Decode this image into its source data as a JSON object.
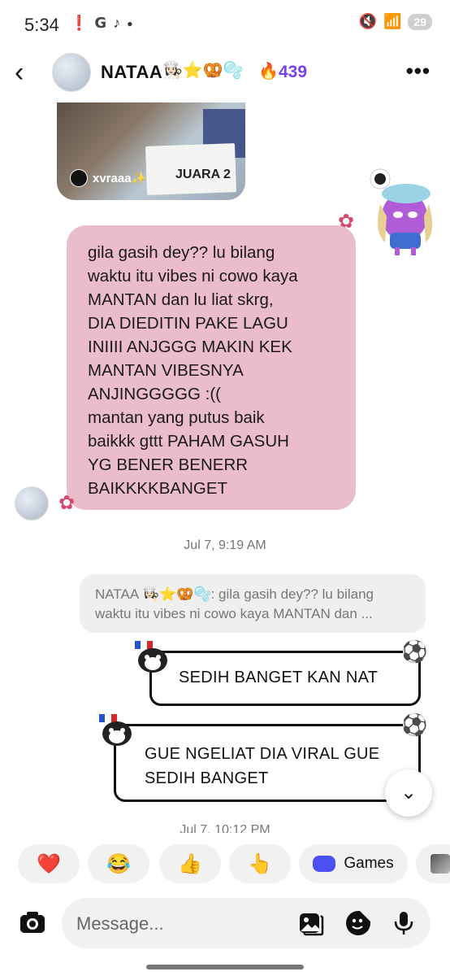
{
  "status_bar": {
    "time": "5:34",
    "left_icons": [
      "alert-icon",
      "g-icon",
      "tiktok-icon",
      "dot"
    ],
    "battery": "29"
  },
  "header": {
    "name": "NATAA",
    "name_emojis": "👩🏻‍🍳⭐🥨🫧",
    "streak_icon": "flame-icon",
    "streak": "439",
    "more_label": "•••"
  },
  "shared_video": {
    "username": "xvraaa✨",
    "sign_text": "JUARA 2"
  },
  "messages": {
    "incoming_text": "gila gasih dey?? lu bilang\nwaktu itu vibes ni cowo kaya\nMANTAN dan lu liat skrg,\nDIA DIEDITIN PAKE LAGU\nINIIII ANJGGG MAKIN KEK\nMANTAN VIBESNYA\nANJINGGGGG :((\nmantan yang putus baik\nbaikkk gttt PAHAM GASUH\nYG BENER BENERR\nBAIKKKKBANGET",
    "timestamp_1": "Jul 7, 9:19 AM",
    "reply_quote": "NATAA 👩🏻‍🍳⭐🥨🫧: gila gasih dey?? lu bilang waktu itu vibes ni cowo kaya MANTAN dan ...",
    "outgoing_1": "SEDIH BANGET KAN NAT",
    "outgoing_2_line1": "GUE NGELIAT DIA VIRAL GUE",
    "outgoing_2_line2": "SEDIH BANGET",
    "timestamp_2": "Jul 7, 10:12 PM"
  },
  "quick_replies": {
    "heart": "❤️",
    "laugh": "😂",
    "thumbs": "👍",
    "point": "👆",
    "games_label": "Games"
  },
  "composer": {
    "placeholder": "Message..."
  },
  "colors": {
    "incoming_bubble": "#ebbcc9",
    "streak_purple": "#7b3ff2",
    "quick_reply_bg": "#f1f1f1",
    "games_blue": "#4d50f0"
  }
}
